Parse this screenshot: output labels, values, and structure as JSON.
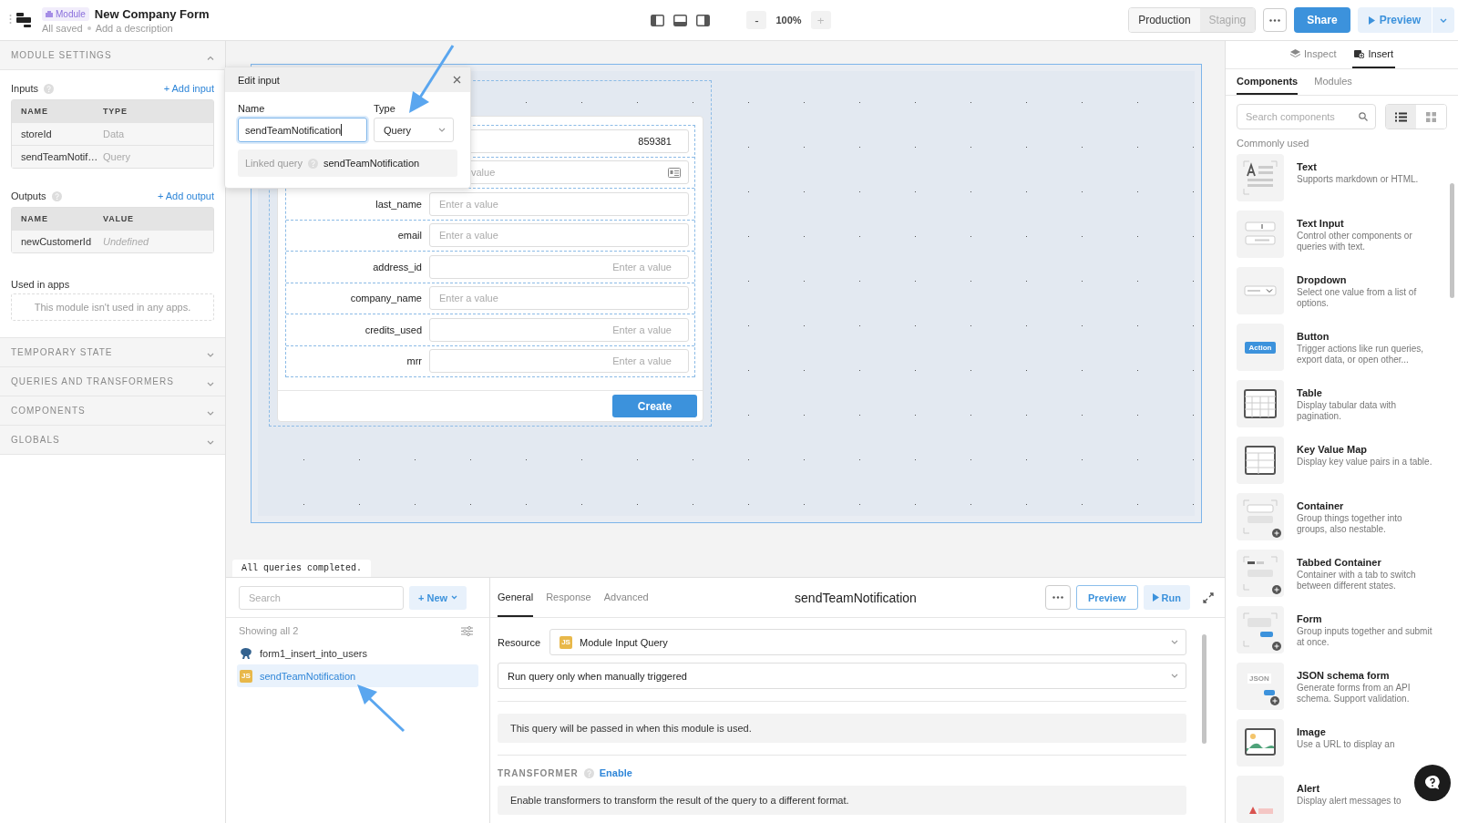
{
  "header": {
    "badge": "Module",
    "title": "New Company Form",
    "status": "All saved",
    "description_placeholder": "Add a description",
    "zoom_out": "-",
    "zoom": "100%",
    "zoom_in": "+",
    "environments": [
      {
        "label": "Production",
        "selected": true
      },
      {
        "label": "Staging",
        "selected": false
      }
    ],
    "share": "Share",
    "preview": "Preview"
  },
  "module_settings": {
    "title": "MODULE SETTINGS",
    "expanded": true,
    "inputs": {
      "title": "Inputs",
      "add": "+ Add input",
      "columns": [
        "NAME",
        "TYPE"
      ],
      "rows": [
        [
          "storeId",
          "Data"
        ],
        [
          "sendTeamNotif…",
          "Query"
        ]
      ]
    },
    "outputs": {
      "title": "Outputs",
      "add": "+ Add output",
      "columns": [
        "NAME",
        "VALUE"
      ],
      "rows": [
        [
          "newCustomerId",
          "Undefined"
        ]
      ]
    },
    "used_in_apps": {
      "title": "Used in apps",
      "empty_text": "This module isn't used in any apps."
    }
  },
  "sections": [
    {
      "title": "TEMPORARY STATE",
      "expanded": false
    },
    {
      "title": "QUERIES AND TRANSFORMERS",
      "expanded": false
    },
    {
      "title": "COMPONENTS",
      "expanded": false
    },
    {
      "title": "GLOBALS",
      "expanded": false
    }
  ],
  "form": {
    "fields": [
      {
        "kind": "number",
        "value": "859381"
      },
      {
        "kind": "covered",
        "placeholder": "value"
      },
      {
        "kind": "text",
        "label": "last_name",
        "placeholder": "Enter a value"
      },
      {
        "kind": "text",
        "label": "email",
        "placeholder": "Enter a value"
      },
      {
        "kind": "number",
        "label": "address_id",
        "placeholder": "Enter a value"
      },
      {
        "kind": "text",
        "label": "company_name",
        "placeholder": "Enter a value"
      },
      {
        "kind": "number",
        "label": "credits_used",
        "placeholder": "Enter a value"
      },
      {
        "kind": "number",
        "label": "mrr",
        "placeholder": "Enter a value"
      }
    ],
    "submit": "Create"
  },
  "edit_input": {
    "title": "Edit input",
    "name_label": "Name",
    "name_value": "sendTeamNotification",
    "type_label": "Type",
    "type_value": "Query",
    "linked_label": "Linked query",
    "linked_value": "sendTeamNotification"
  },
  "status": "All queries completed.",
  "queries": {
    "search_placeholder": "Search",
    "new": "+ New",
    "count": "Showing all 2",
    "items": [
      {
        "kind": "database",
        "name": "form1_insert_into_users",
        "selected": false
      },
      {
        "kind": "js",
        "badge": "JS",
        "name": "sendTeamNotification",
        "selected": true
      }
    ]
  },
  "editor": {
    "tabs": [
      {
        "label": "General",
        "selected": true
      },
      {
        "label": "Response",
        "selected": false
      },
      {
        "label": "Advanced",
        "selected": false
      }
    ],
    "title": "sendTeamNotification",
    "preview": "Preview",
    "run": "Run",
    "resource_label": "Resource",
    "resource_badge": "JS",
    "resource": "Module Input Query",
    "trigger": "Run query only when manually triggered",
    "info": "This query will be passed in when this module is used.",
    "transformer_title": "TRANSFORMER",
    "transformer_link": "Enable",
    "transformer_info": "Enable transformers to transform the result of the query to a different format."
  },
  "insert_panel": {
    "tabs": [
      {
        "label": "Inspect",
        "selected": false
      },
      {
        "label": "Insert",
        "selected": true
      }
    ],
    "subtabs": [
      {
        "label": "Components",
        "selected": true
      },
      {
        "label": "Modules",
        "selected": false
      }
    ],
    "search_placeholder": "Search components",
    "view_modes": [
      {
        "kind": "list",
        "selected": true
      },
      {
        "kind": "grid",
        "selected": false
      }
    ],
    "group": "Commonly used",
    "components": [
      {
        "kind": "text",
        "name": "Text",
        "description": "Supports markdown or HTML."
      },
      {
        "kind": "input",
        "name": "Text Input",
        "description": "Control other components or queries with text."
      },
      {
        "kind": "dropdown",
        "name": "Dropdown",
        "description": "Select one value from a list of options."
      },
      {
        "kind": "button",
        "icon_text": "Action",
        "name": "Button",
        "description": "Trigger actions like run queries, export data, or open other..."
      },
      {
        "kind": "table",
        "name": "Table",
        "description": "Display tabular data with pagination."
      },
      {
        "kind": "keyvalue",
        "name": "Key Value Map",
        "description": "Display key value pairs in a table."
      },
      {
        "kind": "container",
        "name": "Container",
        "description": "Group things together into groups, also nestable."
      },
      {
        "kind": "tabbed",
        "name": "Tabbed Container",
        "description": "Container with a tab to switch between different states."
      },
      {
        "kind": "form",
        "name": "Form",
        "description": "Group inputs together and submit at once."
      },
      {
        "kind": "json",
        "icon_text": "JSON",
        "name": "JSON schema form",
        "description": "Generate forms from an API schema. Support validation."
      },
      {
        "kind": "image",
        "name": "Image",
        "description": "Use a URL to display an"
      },
      {
        "kind": "alert",
        "name": "Alert",
        "description": "Display alert messages to"
      }
    ]
  }
}
